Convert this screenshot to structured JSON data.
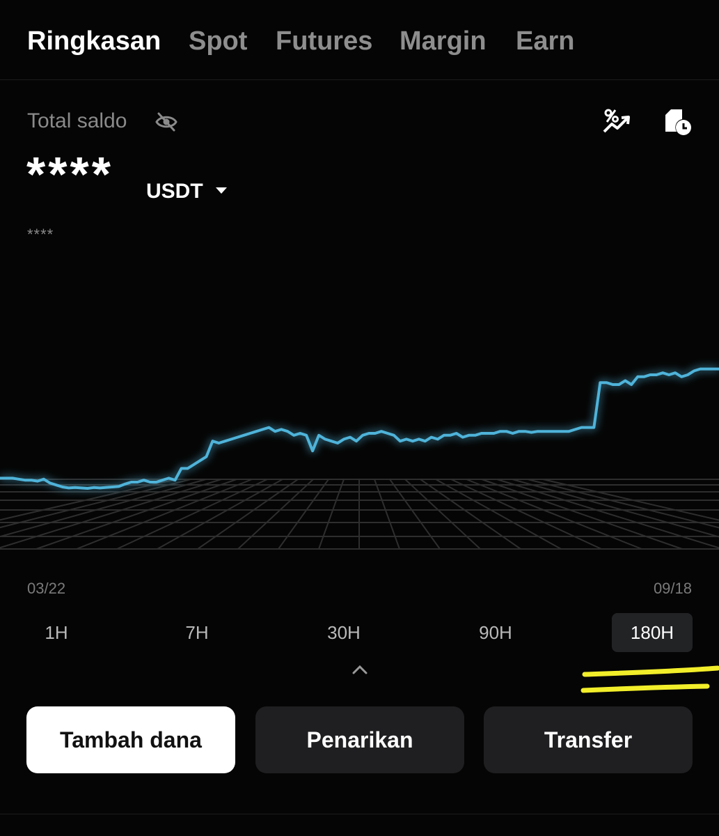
{
  "tabs": [
    {
      "label": "Ringkasan",
      "active": true
    },
    {
      "label": "Spot",
      "active": false
    },
    {
      "label": "Futures",
      "active": false
    },
    {
      "label": "Margin",
      "active": false
    },
    {
      "label": "Earn",
      "active": false
    }
  ],
  "balance": {
    "label": "Total saldo",
    "value": "****",
    "currency": "USDT",
    "sub_value": "****",
    "hidden_icon": "eye-off-icon"
  },
  "header_icons": [
    "pnl-analysis-icon",
    "history-icon"
  ],
  "chart": {
    "start_date": "03/22",
    "end_date": "09/18",
    "line_color": "#4fb3d9",
    "points": [
      0.12,
      0.12,
      0.12,
      0.115,
      0.11,
      0.11,
      0.105,
      0.115,
      0.095,
      0.085,
      0.075,
      0.07,
      0.072,
      0.07,
      0.068,
      0.072,
      0.07,
      0.073,
      0.075,
      0.078,
      0.09,
      0.1,
      0.1,
      0.11,
      0.1,
      0.1,
      0.11,
      0.12,
      0.11,
      0.17,
      0.17,
      0.19,
      0.21,
      0.23,
      0.31,
      0.3,
      0.31,
      0.32,
      0.33,
      0.34,
      0.35,
      0.36,
      0.37,
      0.38,
      0.36,
      0.37,
      0.36,
      0.34,
      0.35,
      0.34,
      0.26,
      0.34,
      0.32,
      0.31,
      0.3,
      0.32,
      0.33,
      0.31,
      0.34,
      0.35,
      0.35,
      0.36,
      0.35,
      0.34,
      0.31,
      0.32,
      0.31,
      0.32,
      0.31,
      0.33,
      0.32,
      0.34,
      0.34,
      0.35,
      0.33,
      0.34,
      0.34,
      0.35,
      0.35,
      0.35,
      0.36,
      0.36,
      0.35,
      0.36,
      0.36,
      0.355,
      0.36,
      0.36,
      0.36,
      0.36,
      0.36,
      0.36,
      0.37,
      0.38,
      0.38,
      0.38,
      0.61,
      0.61,
      0.6,
      0.6,
      0.62,
      0.6,
      0.64,
      0.64,
      0.65,
      0.65,
      0.66,
      0.65,
      0.66,
      0.64,
      0.65,
      0.67,
      0.68,
      0.68,
      0.68,
      0.68
    ],
    "ranges": [
      {
        "label": "1H",
        "active": false
      },
      {
        "label": "7H",
        "active": false
      },
      {
        "label": "30H",
        "active": false
      },
      {
        "label": "90H",
        "active": false
      },
      {
        "label": "180H",
        "active": true
      }
    ]
  },
  "highlight_color": "#f2ee2a",
  "actions": [
    {
      "label": "Tambah dana",
      "style": "primary"
    },
    {
      "label": "Penarikan",
      "style": "secondary"
    },
    {
      "label": "Transfer",
      "style": "secondary"
    }
  ]
}
